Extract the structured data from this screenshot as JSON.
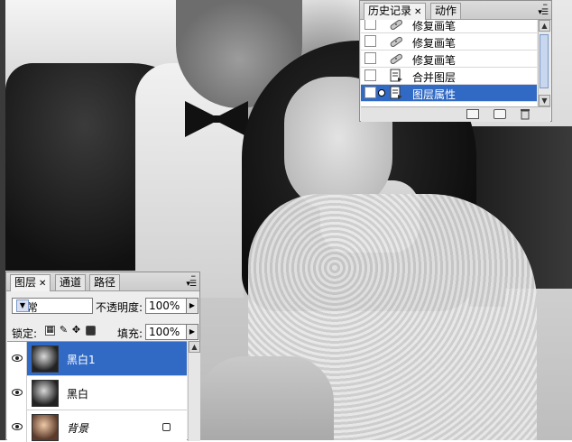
{
  "history_panel": {
    "tabs": [
      {
        "label": "历史记录",
        "active": true,
        "closable": true
      },
      {
        "label": "动作",
        "active": false,
        "closable": false
      }
    ],
    "items": [
      {
        "label": "修复画笔",
        "icon": "healing-brush-icon",
        "selected": false
      },
      {
        "label": "修复画笔",
        "icon": "healing-brush-icon",
        "selected": false
      },
      {
        "label": "修复画笔",
        "icon": "healing-brush-icon",
        "selected": false
      },
      {
        "label": "合并图层",
        "icon": "history-document-icon",
        "selected": false
      },
      {
        "label": "图层属性",
        "icon": "history-document-icon",
        "selected": true
      }
    ],
    "footer_icons": [
      "new-document-from-state-icon",
      "new-snapshot-icon",
      "delete-state-icon"
    ]
  },
  "layers_panel": {
    "tabs": [
      {
        "label": "图层",
        "active": true,
        "closable": true
      },
      {
        "label": "通道",
        "active": false,
        "closable": false
      },
      {
        "label": "路径",
        "active": false,
        "closable": false
      }
    ],
    "blend_mode": "正常",
    "opacity_label": "不透明度:",
    "opacity_value": "100%",
    "lock_label": "锁定:",
    "lock_icons": [
      "lock-transparent-icon",
      "lock-image-icon",
      "lock-position-icon",
      "lock-all-icon"
    ],
    "fill_label": "填充:",
    "fill_value": "100%",
    "layers": [
      {
        "name": "黑白1",
        "visible": true,
        "selected": true,
        "thumbnail": "bw",
        "italic": false,
        "locked": false
      },
      {
        "name": "黑白",
        "visible": true,
        "selected": false,
        "thumbnail": "bw",
        "italic": false,
        "locked": false
      },
      {
        "name": "背景",
        "visible": true,
        "selected": false,
        "thumbnail": "color",
        "italic": true,
        "locked": true
      }
    ]
  },
  "colors": {
    "selection": "#316ac5",
    "panel_bg": "#ededed"
  }
}
